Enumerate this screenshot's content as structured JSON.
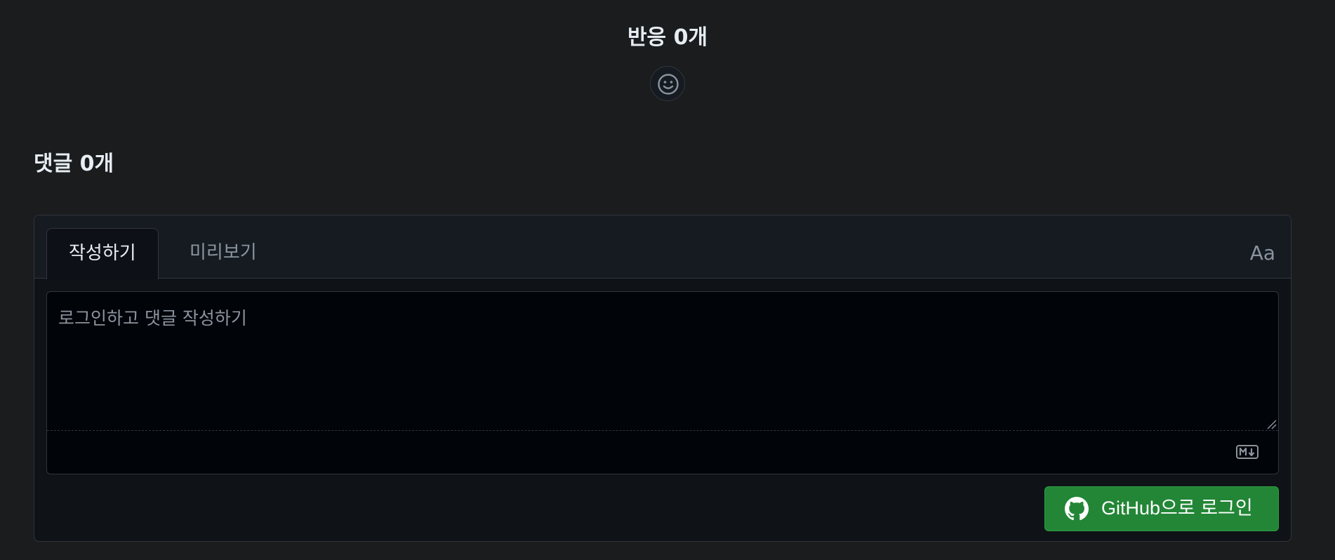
{
  "reactions": {
    "title": "반응 0개",
    "add_reaction_icon": "smiley-icon"
  },
  "comments": {
    "title": "댓글 0개"
  },
  "editor": {
    "tabs": [
      {
        "label": "작성하기",
        "active": true
      },
      {
        "label": "미리보기",
        "active": false
      }
    ],
    "font_toggle_label": "Aa",
    "placeholder": "로그인하고 댓글 작성하기",
    "value": "",
    "markdown_icon": "markdown-icon",
    "login_button_label": "GitHub으로 로그인",
    "login_button_icon": "github-icon"
  },
  "colors": {
    "background": "#1b1c1e",
    "panel": "#161b22",
    "input_bg": "#010409",
    "border": "#30363d",
    "primary_button": "#238636",
    "text": "#e6edf3",
    "muted_text": "#8b949e"
  }
}
